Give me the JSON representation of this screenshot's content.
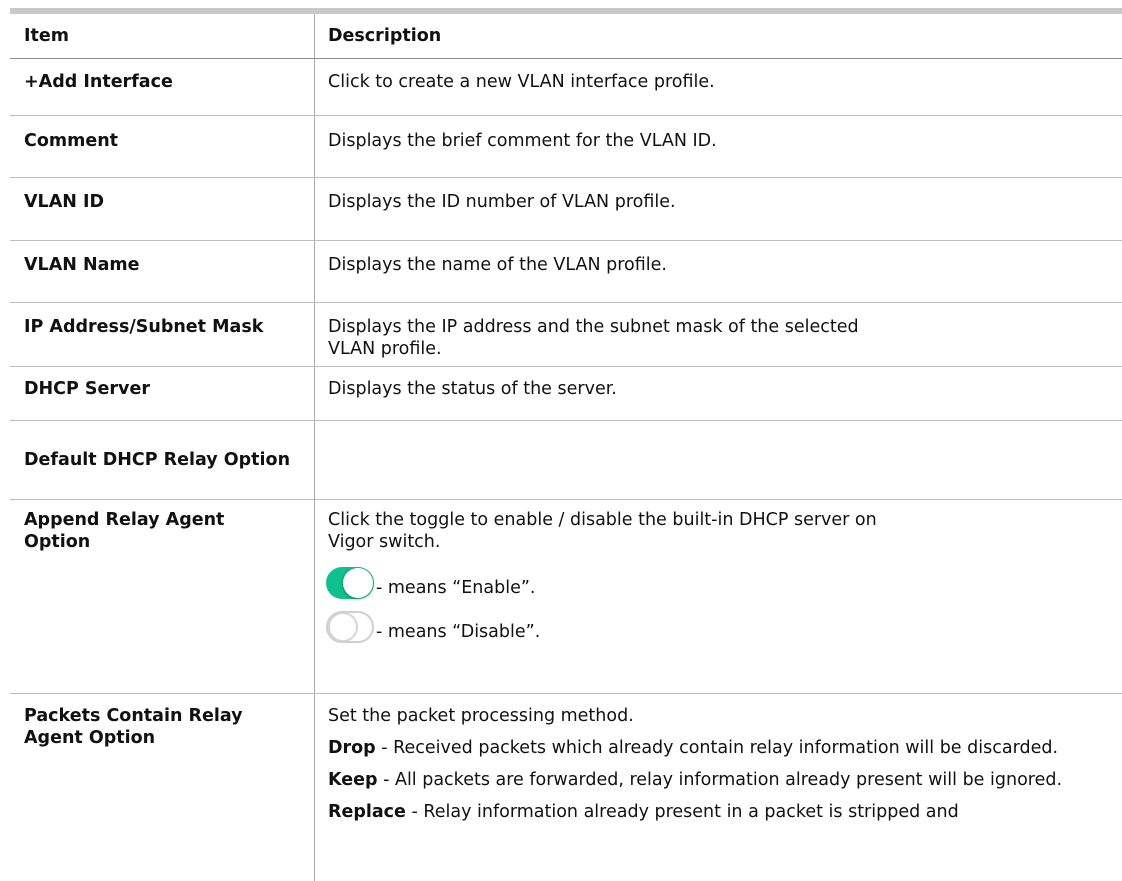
{
  "table": {
    "header": {
      "item": "Item",
      "description": "Description"
    },
    "rows": [
      {
        "item": "+Add Interface",
        "description": "Click to create a new VLAN interface profile."
      },
      {
        "item": "Comment",
        "description": "Displays the brief comment for the VLAN ID."
      },
      {
        "item": "VLAN ID",
        "description": "Displays the ID number of VLAN profile."
      },
      {
        "item": "VLAN Name",
        "description": "Displays the name of the VLAN profile."
      },
      {
        "item": "IP Address/Subnet Mask",
        "description": "Displays the IP address and the subnet mask of the selected VLAN profile."
      },
      {
        "item": "DHCP Server",
        "description": "Displays the status of the server."
      }
    ],
    "section_title": "Default DHCP Relay Option",
    "relay_rows": {
      "append": {
        "item": "Append Relay Agent Option",
        "description": "Click the toggle to enable / disable the built-in DHCP server on Vigor switch.",
        "enable_text": "- means “Enable”.",
        "disable_text": "- means “Disable”."
      },
      "packets": {
        "item": "Packets Contain Relay Agent Option",
        "intro": "Set the packet processing method.",
        "drop_label": "Drop",
        "drop_text": " - Received packets which already contain relay information will be discarded.",
        "keep_label": "Keep",
        "keep_text": " - All packets are forwarded, relay information already present will be ignored.",
        "replace_label": "Replace",
        "replace_text": " - Relay information already present in a packet is stripped and"
      }
    }
  },
  "colors": {
    "toggle_on": "#10c08e",
    "toggle_off_border": "#cfcfcf"
  },
  "icons": {
    "toggle_on": "toggle-on-icon",
    "toggle_off": "toggle-off-icon"
  }
}
